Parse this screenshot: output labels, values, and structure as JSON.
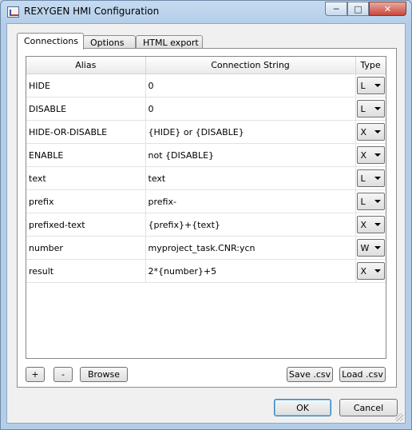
{
  "window": {
    "title": "REXYGEN HMI Configuration"
  },
  "tabs": [
    {
      "label": "Connections",
      "active": true
    },
    {
      "label": "Options",
      "active": false
    },
    {
      "label": "HTML export",
      "active": false
    }
  ],
  "table": {
    "columns": [
      "Alias",
      "Connection String",
      "Type"
    ],
    "rows": [
      {
        "alias": "HIDE",
        "connection": "0",
        "type": "L"
      },
      {
        "alias": "DISABLE",
        "connection": "0",
        "type": "L"
      },
      {
        "alias": "HIDE-OR-DISABLE",
        "connection": "{HIDE} or {DISABLE}",
        "type": "X"
      },
      {
        "alias": "ENABLE",
        "connection": "not {DISABLE}",
        "type": "X"
      },
      {
        "alias": "text",
        "connection": "text",
        "type": "L"
      },
      {
        "alias": "prefix",
        "connection": "prefix-",
        "type": "L"
      },
      {
        "alias": "prefixed-text",
        "connection": "{prefix}+{text}",
        "type": "X"
      },
      {
        "alias": "number",
        "connection": "myproject_task.CNR:ycn",
        "type": "W"
      },
      {
        "alias": "result",
        "connection": "2*{number}+5",
        "type": "X"
      }
    ]
  },
  "toolbar": {
    "add_label": "+",
    "remove_label": "-",
    "browse_label": "Browse",
    "save_csv_label": "Save .csv",
    "load_csv_label": "Load .csv"
  },
  "dialog": {
    "ok_label": "OK",
    "cancel_label": "Cancel"
  },
  "icons": {
    "app": "rexygen-app-icon",
    "minimize": "minimize-icon",
    "maximize": "maximize-icon",
    "close": "close-icon",
    "dropdown": "chevron-down-icon",
    "grip": "resize-grip-icon"
  }
}
